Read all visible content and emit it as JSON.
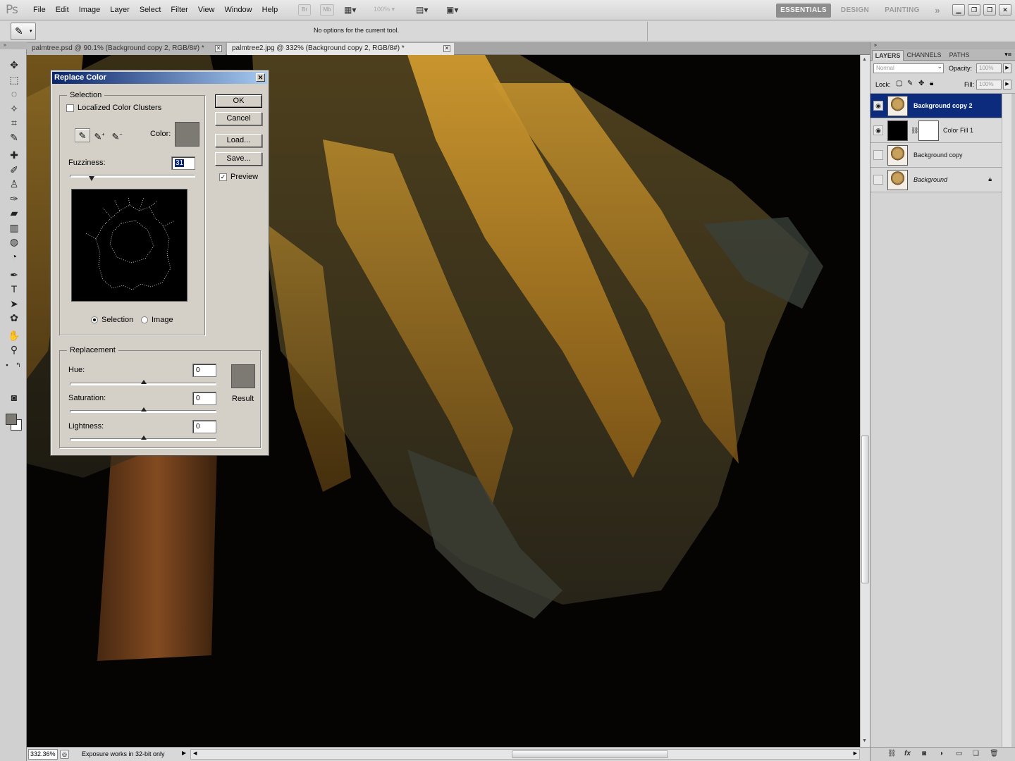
{
  "menubar": {
    "logo": "Ps",
    "items": [
      "File",
      "Edit",
      "Image",
      "Layer",
      "Select",
      "Filter",
      "View",
      "Window",
      "Help"
    ],
    "bridge_label": "Br",
    "minibridge_label": "Mb",
    "zoom": "100%",
    "workspaces": [
      "ESSENTIALS",
      "DESIGN",
      "PAINTING"
    ],
    "more": "»"
  },
  "options": {
    "text": "No options for the current tool."
  },
  "documents": [
    {
      "title": "palmtree.psd @ 90.1% (Background copy 2, RGB/8#) *",
      "active": false
    },
    {
      "title": "palmtree2.jpg @ 332% (Background copy 2, RGB/8#) *",
      "active": true
    }
  ],
  "status": {
    "zoom": "332.36%",
    "text": "Exposure works in 32-bit only"
  },
  "panel": {
    "tabs": [
      "LAYERS",
      "CHANNELS",
      "PATHS"
    ],
    "blend_mode": "Normal",
    "opacity_label": "Opacity:",
    "opacity": "100%",
    "lock_label": "Lock:",
    "fill_label": "Fill:",
    "fill": "100%",
    "layers": [
      {
        "name": "Background copy 2",
        "visible": true,
        "selected": true
      },
      {
        "name": "Color Fill 1",
        "visible": true,
        "selected": false
      },
      {
        "name": "Background copy",
        "visible": false,
        "selected": false
      },
      {
        "name": "Background",
        "visible": false,
        "selected": false,
        "locked": true
      }
    ]
  },
  "dialog": {
    "title": "Replace Color",
    "selection_legend": "Selection",
    "localized_label": "Localized Color Clusters",
    "localized_checked": false,
    "color_label": "Color:",
    "color": "#7c7a72",
    "fuzziness_label": "Fuzziness:",
    "fuzziness": "31",
    "fuzziness_max": 200,
    "radio_selection": "Selection",
    "radio_image": "Image",
    "radio_selected": "Selection",
    "replacement_legend": "Replacement",
    "hue_label": "Hue:",
    "hue": "0",
    "saturation_label": "Saturation:",
    "saturation": "0",
    "lightness_label": "Lightness:",
    "lightness": "0",
    "result_label": "Result",
    "result_color": "#7c7a72",
    "buttons": {
      "ok": "OK",
      "cancel": "Cancel",
      "load": "Load...",
      "save": "Save..."
    },
    "preview_label": "Preview",
    "preview_checked": true
  }
}
